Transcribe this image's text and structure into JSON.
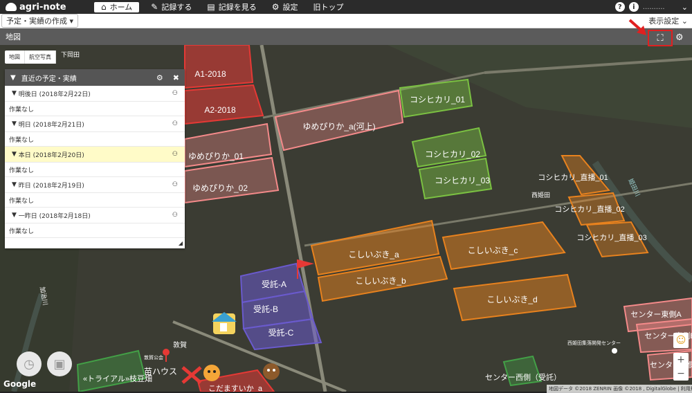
{
  "app": {
    "name": "agri-note"
  },
  "nav": [
    {
      "label": "ホーム",
      "icon": "home-icon",
      "glyph": "⌂",
      "active": true
    },
    {
      "label": "記録する",
      "icon": "pencil-icon",
      "glyph": "✎"
    },
    {
      "label": "記録を見る",
      "icon": "notebook-icon",
      "glyph": "▤"
    },
    {
      "label": "設定",
      "icon": "gear-icon",
      "glyph": "⚙"
    },
    {
      "label": "旧トップ",
      "icon": "",
      "glyph": ""
    }
  ],
  "topbar": {
    "help_glyph": "?",
    "info_glyph": "i",
    "username": "..........",
    "chevron": "⌄"
  },
  "subbar": {
    "plan_button": "予定・実績の作成 ▾",
    "display_settings": "表示設定 ⌄"
  },
  "mapbar": {
    "title": "地図",
    "fullscreen_glyph": "⛶",
    "settings_glyph": "⚙"
  },
  "map_tabs": [
    "地図",
    "航空写真"
  ],
  "panel": {
    "title": "直近の予定・実績",
    "settings_glyph": "⚙",
    "close_glyph": "✖",
    "days": [
      {
        "label": "明後日 (2018年2月22日)",
        "note": "作業なし",
        "today": false
      },
      {
        "label": "明日 (2018年2月21日)",
        "note": "作業なし",
        "today": false
      },
      {
        "label": "本日 (2018年2月20日)",
        "note": "作業なし",
        "today": true
      },
      {
        "label": "昨日 (2018年2月19日)",
        "note": "作業なし",
        "today": false
      },
      {
        "label": "一昨日 (2018年2月18日)",
        "note": "作業なし",
        "today": false
      }
    ]
  },
  "map_places": [
    "下岡田",
    "西姫田",
    "加治川",
    "姫田川",
    "敦賀",
    "敦賀公会",
    "苗ハウス",
    "西姫田集落開発センター"
  ],
  "fields": [
    {
      "name": "A1-2018",
      "color": "#e53935"
    },
    {
      "name": "A2-2018",
      "color": "#e53935"
    },
    {
      "name": "ゆめぴりか_a(河上)",
      "color": "#f48a8a"
    },
    {
      "name": "ゆめぴりか_01",
      "color": "#f48a8a"
    },
    {
      "name": "ゆめぴりか_02",
      "color": "#f48a8a"
    },
    {
      "name": "コシヒカリ_01",
      "color": "#7bc142"
    },
    {
      "name": "コシヒカリ_02",
      "color": "#7bc142"
    },
    {
      "name": "コシヒカリ_03",
      "color": "#7bc142"
    },
    {
      "name": "コシヒカリ_直播_01",
      "color": "#e8821e"
    },
    {
      "name": "コシヒカリ_直播_02",
      "color": "#e8821e"
    },
    {
      "name": "コシヒカリ_直播_03",
      "color": "#e8821e"
    },
    {
      "name": "こしいぶき_a",
      "color": "#e8821e"
    },
    {
      "name": "こしいぶき_b",
      "color": "#e8821e"
    },
    {
      "name": "こしいぶき_c",
      "color": "#e8821e"
    },
    {
      "name": "こしいぶき_d",
      "color": "#e8821e"
    },
    {
      "name": "受託-A",
      "color": "#6a5acd"
    },
    {
      "name": "受託-B",
      "color": "#6a5acd"
    },
    {
      "name": "受託-C",
      "color": "#6a5acd"
    },
    {
      "name": "センター東側A",
      "color": "#f48a8a"
    },
    {
      "name": "センター東側B",
      "color": "#f48a8a"
    },
    {
      "name": "センター東側C",
      "color": "#f48a8a"
    },
    {
      "name": "センター西側（受託）",
      "color": "#43a047"
    },
    {
      "name": "«トライアル»枝豆畑",
      "color": "#43a047"
    },
    {
      "name": "こだますいか_a",
      "color": "#e53935"
    }
  ],
  "map_controls": {
    "history_glyph": "◷",
    "camera_glyph": "▣",
    "pegman_glyph": "☺",
    "zoom_in": "+",
    "zoom_out": "−"
  },
  "map_footer": {
    "google": "Google",
    "attribution": "地図データ ©2018 ZENRIN 画像 ©2018 , DigitalGlobe | 利用規約"
  }
}
